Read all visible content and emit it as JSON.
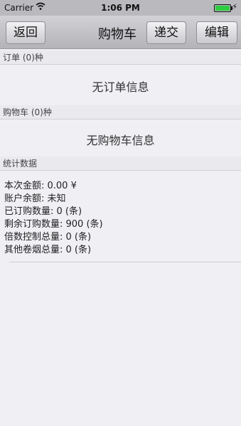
{
  "status_bar": {
    "carrier": "Carrier",
    "time": "1:06 PM",
    "battery_charging": "⚡"
  },
  "nav": {
    "back_label": "返回",
    "title": "购物车",
    "submit_label": "递交",
    "edit_label": "编辑"
  },
  "orders": {
    "header": "订单 (0)种",
    "empty_text": "无订单信息"
  },
  "cart": {
    "header": "购物车 (0)种",
    "empty_text": "无购物车信息"
  },
  "stats": {
    "header": "统计数据",
    "lines": [
      "本次金额: 0.00 ¥",
      "账户余额: 未知",
      "已订购数量: 0 (条)",
      "剩余订购数量: 900 (条)",
      "倍数控制总量: 0 (条)",
      "其他卷烟总量: 0 (条)"
    ]
  }
}
